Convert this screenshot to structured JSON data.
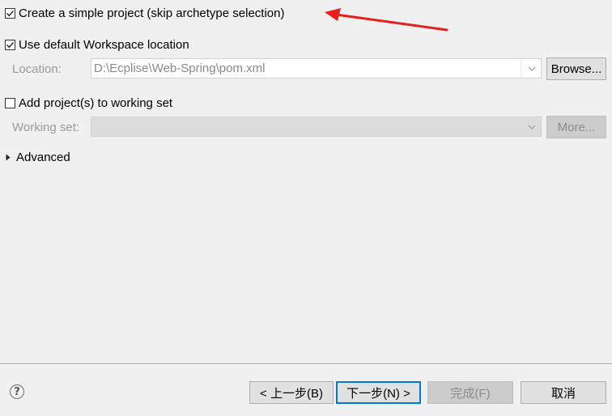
{
  "options": {
    "simple_project": {
      "label": "Create a simple project (skip archetype selection)",
      "checked": true
    },
    "default_workspace": {
      "label": "Use default Workspace location",
      "checked": true
    },
    "location": {
      "label": "Location:",
      "value": "D:\\Ecplise\\Web-Spring\\pom.xml",
      "browse_label": "Browse..."
    },
    "working_set_check": {
      "label": "Add project(s) to working set",
      "checked": false
    },
    "working_set": {
      "label": "Working set:",
      "value": "",
      "more_label": "More..."
    },
    "advanced": {
      "label": "Advanced"
    }
  },
  "footer": {
    "help_icon": "?",
    "back_label": "< 上一步(B)",
    "next_label": "下一步(N) >",
    "finish_label": "完成(F)",
    "cancel_label": "取消"
  },
  "colors": {
    "annotation_arrow": "#e8201c",
    "default_button_border": "#0078d7"
  }
}
